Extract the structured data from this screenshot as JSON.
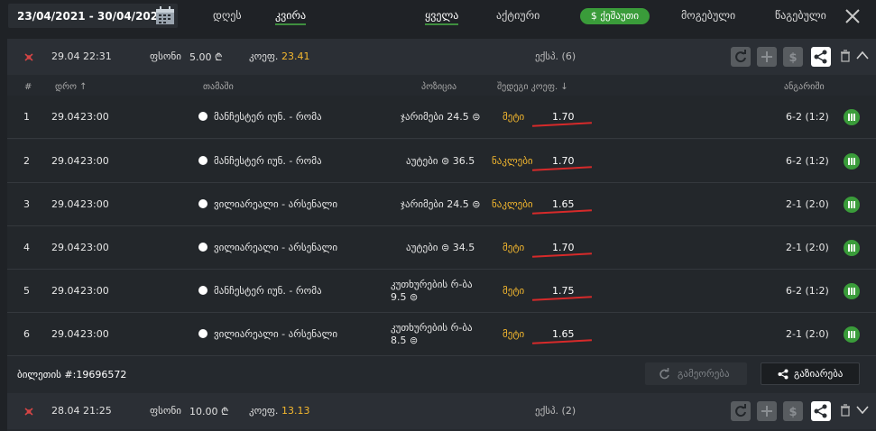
{
  "topbar": {
    "date_range": "23/04/2021 - 30/04/2021",
    "period_tabs": [
      "დღეს",
      "კვირა"
    ],
    "filter_tabs": [
      "ყველა",
      "აქტიური",
      "ქეშაუთი",
      "მოგებული",
      "წაგებული"
    ]
  },
  "bets": [
    {
      "date": "29.04",
      "time": "22:31",
      "stake_label": "ფსონი",
      "stake": "5.00 ₾",
      "odds_label": "კოეფ.",
      "odds": "23.41",
      "type": "ექსპ. (6)",
      "headers": {
        "num": "#",
        "time": "დრო",
        "match": "თამაში",
        "position": "პოზიცია",
        "placed_odds": "შედეგი კოეფ.",
        "result": "ანგარიში"
      },
      "rows": [
        {
          "num": "1",
          "date": "29.04",
          "time": "23:00",
          "match": "მანჩესტერ იუნ. - რომა",
          "position": "ჯარიმები 24.5 ⊜",
          "pick": "მეტი",
          "odds": "1.70",
          "score": "6-2 (1:2)"
        },
        {
          "num": "2",
          "date": "29.04",
          "time": "23:00",
          "match": "მანჩესტერ იუნ. - რომა",
          "position": "აუტები ⊜ 36.5",
          "pick": "ნაკლები",
          "odds": "1.70",
          "score": "6-2 (1:2)"
        },
        {
          "num": "3",
          "date": "29.04",
          "time": "23:00",
          "match": "ვილიარეალი - არსენალი",
          "position": "ჯარიმები 24.5 ⊜",
          "pick": "ნაკლები",
          "odds": "1.65",
          "score": "2-1 (2:0)"
        },
        {
          "num": "4",
          "date": "29.04",
          "time": "23:00",
          "match": "ვილიარეალი - არსენალი",
          "position": "აუტები ⊜ 34.5",
          "pick": "მეტი",
          "odds": "1.70",
          "score": "2-1 (2:0)"
        },
        {
          "num": "5",
          "date": "29.04",
          "time": "23:00",
          "match": "მანჩესტერ იუნ. - რომა",
          "position_line1": "კუთხურების რ-ბა",
          "position_line2": "9.5 ⊜",
          "pick": "მეტი",
          "odds": "1.75",
          "score": "6-2 (1:2)"
        },
        {
          "num": "6",
          "date": "29.04",
          "time": "23:00",
          "match": "ვილიარეალი - არსენალი",
          "position_line1": "კუთხურების რ-ბა",
          "position_line2": "8.5 ⊜",
          "pick": "მეტი",
          "odds": "1.65",
          "score": "2-1 (2:0)"
        }
      ],
      "ticket_label": "ბილეთის #:19696572",
      "repeat_label": "გამეორება",
      "share_label": "გაზიარება"
    },
    {
      "date": "28.04",
      "time": "21:25",
      "stake_label": "ფსონი",
      "stake": "10.00 ₾",
      "odds_label": "კოეფ.",
      "odds": "13.13",
      "type": "ექსპ. (2)"
    }
  ],
  "colors": {
    "accent_green": "#3a9c3a",
    "odds_yellow": "#f5b82e",
    "underline_red": "#d62a2a"
  }
}
